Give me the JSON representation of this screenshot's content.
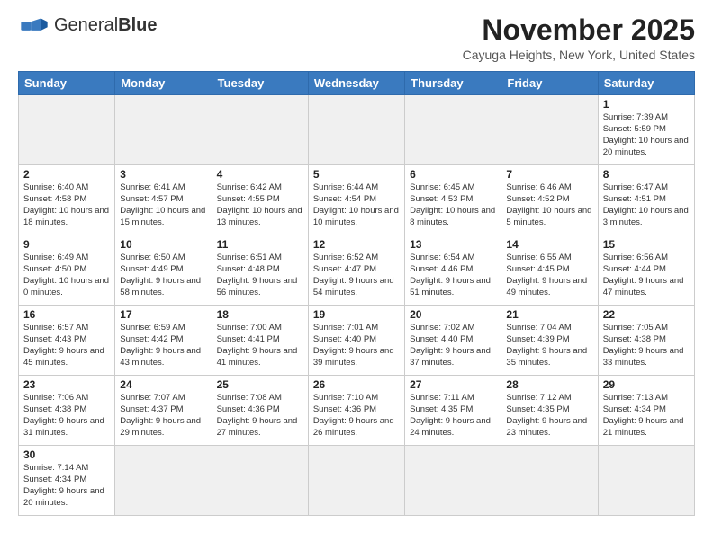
{
  "header": {
    "logo_general": "General",
    "logo_blue": "Blue",
    "month_title": "November 2025",
    "location": "Cayuga Heights, New York, United States"
  },
  "weekdays": [
    "Sunday",
    "Monday",
    "Tuesday",
    "Wednesday",
    "Thursday",
    "Friday",
    "Saturday"
  ],
  "days": {
    "1": "Sunrise: 7:39 AM\nSunset: 5:59 PM\nDaylight: 10 hours and 20 minutes.",
    "2": "Sunrise: 6:40 AM\nSunset: 4:58 PM\nDaylight: 10 hours and 18 minutes.",
    "3": "Sunrise: 6:41 AM\nSunset: 4:57 PM\nDaylight: 10 hours and 15 minutes.",
    "4": "Sunrise: 6:42 AM\nSunset: 4:55 PM\nDaylight: 10 hours and 13 minutes.",
    "5": "Sunrise: 6:44 AM\nSunset: 4:54 PM\nDaylight: 10 hours and 10 minutes.",
    "6": "Sunrise: 6:45 AM\nSunset: 4:53 PM\nDaylight: 10 hours and 8 minutes.",
    "7": "Sunrise: 6:46 AM\nSunset: 4:52 PM\nDaylight: 10 hours and 5 minutes.",
    "8": "Sunrise: 6:47 AM\nSunset: 4:51 PM\nDaylight: 10 hours and 3 minutes.",
    "9": "Sunrise: 6:49 AM\nSunset: 4:50 PM\nDaylight: 10 hours and 0 minutes.",
    "10": "Sunrise: 6:50 AM\nSunset: 4:49 PM\nDaylight: 9 hours and 58 minutes.",
    "11": "Sunrise: 6:51 AM\nSunset: 4:48 PM\nDaylight: 9 hours and 56 minutes.",
    "12": "Sunrise: 6:52 AM\nSunset: 4:47 PM\nDaylight: 9 hours and 54 minutes.",
    "13": "Sunrise: 6:54 AM\nSunset: 4:46 PM\nDaylight: 9 hours and 51 minutes.",
    "14": "Sunrise: 6:55 AM\nSunset: 4:45 PM\nDaylight: 9 hours and 49 minutes.",
    "15": "Sunrise: 6:56 AM\nSunset: 4:44 PM\nDaylight: 9 hours and 47 minutes.",
    "16": "Sunrise: 6:57 AM\nSunset: 4:43 PM\nDaylight: 9 hours and 45 minutes.",
    "17": "Sunrise: 6:59 AM\nSunset: 4:42 PM\nDaylight: 9 hours and 43 minutes.",
    "18": "Sunrise: 7:00 AM\nSunset: 4:41 PM\nDaylight: 9 hours and 41 minutes.",
    "19": "Sunrise: 7:01 AM\nSunset: 4:40 PM\nDaylight: 9 hours and 39 minutes.",
    "20": "Sunrise: 7:02 AM\nSunset: 4:40 PM\nDaylight: 9 hours and 37 minutes.",
    "21": "Sunrise: 7:04 AM\nSunset: 4:39 PM\nDaylight: 9 hours and 35 minutes.",
    "22": "Sunrise: 7:05 AM\nSunset: 4:38 PM\nDaylight: 9 hours and 33 minutes.",
    "23": "Sunrise: 7:06 AM\nSunset: 4:38 PM\nDaylight: 9 hours and 31 minutes.",
    "24": "Sunrise: 7:07 AM\nSunset: 4:37 PM\nDaylight: 9 hours and 29 minutes.",
    "25": "Sunrise: 7:08 AM\nSunset: 4:36 PM\nDaylight: 9 hours and 27 minutes.",
    "26": "Sunrise: 7:10 AM\nSunset: 4:36 PM\nDaylight: 9 hours and 26 minutes.",
    "27": "Sunrise: 7:11 AM\nSunset: 4:35 PM\nDaylight: 9 hours and 24 minutes.",
    "28": "Sunrise: 7:12 AM\nSunset: 4:35 PM\nDaylight: 9 hours and 23 minutes.",
    "29": "Sunrise: 7:13 AM\nSunset: 4:34 PM\nDaylight: 9 hours and 21 minutes.",
    "30": "Sunrise: 7:14 AM\nSunset: 4:34 PM\nDaylight: 9 hours and 20 minutes."
  }
}
